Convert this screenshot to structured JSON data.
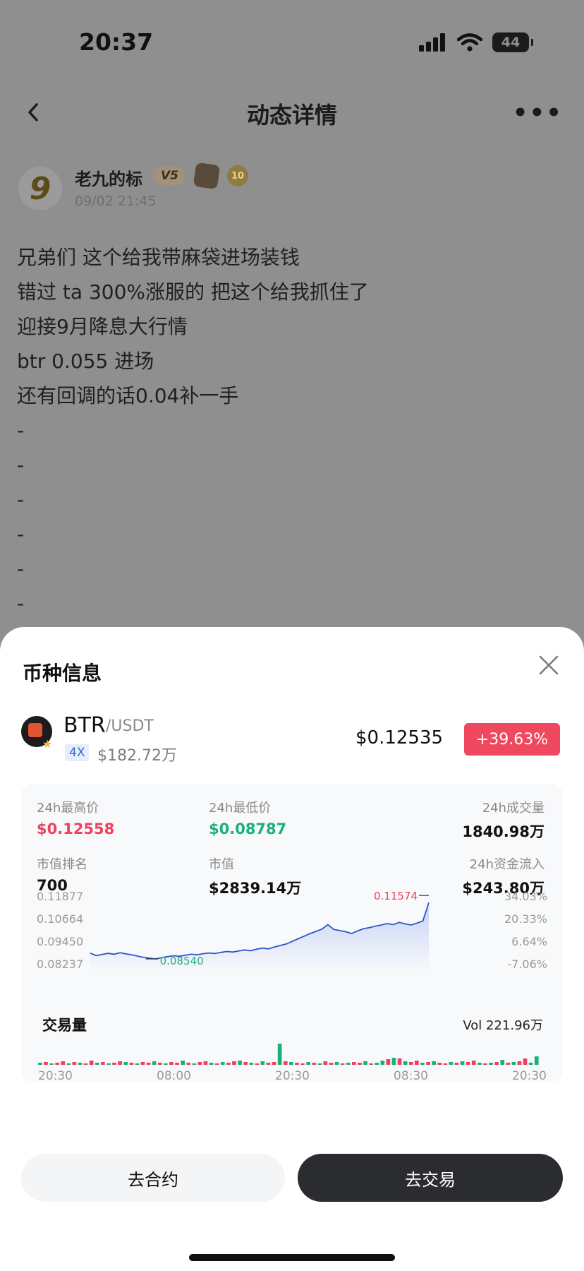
{
  "status_bar": {
    "time": "20:37",
    "battery": "44"
  },
  "nav": {
    "title": "动态详情"
  },
  "post": {
    "author": "老九的标",
    "avatar_glyph": "9",
    "vip_badge": "V5",
    "level_badge": "10",
    "time": "09/02 21:45",
    "lines": [
      "兄弟们 这个给我带麻袋进场装钱",
      "错过 ta 300%涨服的 把这个给我抓住了",
      "迎接9月降息大行情",
      "btr 0.055 进场",
      "还有回调的话0.04补一手",
      "-",
      "-",
      "-",
      "-",
      "-",
      "-"
    ]
  },
  "sheet": {
    "title": "币种信息",
    "coin": {
      "symbol": "BTR",
      "quote": "/USDT",
      "leverage": "4X",
      "market_cap": "$182.72万",
      "price": "$0.12535",
      "change": "+39.63%"
    },
    "stats": {
      "high_label": "24h最高价",
      "high_value": "$0.12558",
      "low_label": "24h最低价",
      "low_value": "$0.08787",
      "volume_label": "24h成交量",
      "volume_value": "1840.98万",
      "rank_label": "市值排名",
      "rank_value": "700",
      "cap_label": "市值",
      "cap_value": "$2839.14万",
      "inflow_label": "24h资金流入",
      "inflow_value": "$243.80万"
    },
    "volume": {
      "title": "交易量",
      "total": "Vol 221.96万"
    },
    "buttons": {
      "contract": "去合约",
      "trade": "去交易"
    }
  },
  "colors": {
    "up": "#ef4060",
    "down": "#19b17a",
    "line": "#2f56c7",
    "overlay": "#8f8f8f"
  },
  "chart_data": [
    {
      "type": "area",
      "y_ticks": [
        "0.11877",
        "0.10664",
        "0.09450",
        "0.08237"
      ],
      "pct_ticks": [
        "34.03%",
        "20.33%",
        "6.64%",
        "-7.06%"
      ],
      "x_ticks": [
        "20:30",
        "08:00",
        "20:30",
        "08:30",
        "20:30"
      ],
      "annotations": {
        "max": "0.11574",
        "min": "0.08540"
      },
      "ylim": [
        0.08237,
        0.11877
      ],
      "values": [
        0.0885,
        0.0872,
        0.0878,
        0.0884,
        0.0879,
        0.0887,
        0.0881,
        0.0876,
        0.0869,
        0.0862,
        0.0858,
        0.0854,
        0.0861,
        0.0866,
        0.0871,
        0.0868,
        0.0874,
        0.0879,
        0.0876,
        0.0882,
        0.0886,
        0.0883,
        0.0889,
        0.0894,
        0.0891,
        0.0897,
        0.0902,
        0.0898,
        0.0906,
        0.0912,
        0.0908,
        0.0918,
        0.0926,
        0.0934,
        0.0948,
        0.0962,
        0.0976,
        0.099,
        0.1002,
        0.1014,
        0.1038,
        0.1012,
        0.1006,
        0.1,
        0.099,
        0.1004,
        0.1016,
        0.1022,
        0.103,
        0.1036,
        0.1044,
        0.1038,
        0.105,
        0.1042,
        0.1036,
        0.1046,
        0.1058,
        0.1157
      ]
    },
    {
      "type": "bar",
      "title": "交易量",
      "total": "Vol 221.96万",
      "values": [
        3,
        4,
        2,
        3,
        5,
        2,
        4,
        3,
        2,
        6,
        3,
        4,
        2,
        3,
        5,
        4,
        3,
        2,
        4,
        3,
        5,
        3,
        2,
        4,
        3,
        6,
        3,
        2,
        4,
        5,
        3,
        2,
        4,
        3,
        5,
        6,
        4,
        3,
        2,
        5,
        3,
        4,
        30,
        5,
        4,
        3,
        2,
        4,
        3,
        2,
        5,
        3,
        4,
        2,
        3,
        4,
        3,
        5,
        2,
        3,
        6,
        8,
        10,
        9,
        5,
        4,
        6,
        3,
        4,
        5,
        3,
        2,
        4,
        3,
        5,
        4,
        6,
        3,
        2,
        3,
        4,
        7,
        3,
        4,
        5,
        9,
        3,
        12
      ],
      "up_flags": [
        1,
        0,
        1,
        0,
        0,
        1,
        0,
        1,
        0,
        0,
        1,
        0,
        1,
        0,
        0,
        1,
        0,
        1,
        0,
        0,
        1,
        0,
        1,
        0,
        0,
        1,
        0,
        1,
        0,
        0,
        1,
        0,
        1,
        0,
        0,
        1,
        0,
        1,
        0,
        1,
        0,
        0,
        1,
        0,
        1,
        0,
        0,
        1,
        0,
        1,
        0,
        0,
        1,
        0,
        1,
        0,
        0,
        1,
        0,
        1,
        1,
        0,
        1,
        0,
        1,
        0,
        0,
        1,
        0,
        1,
        0,
        0,
        1,
        0,
        1,
        0,
        0,
        1,
        0,
        1,
        0,
        1,
        0,
        1,
        0,
        0,
        1,
        1
      ]
    }
  ]
}
